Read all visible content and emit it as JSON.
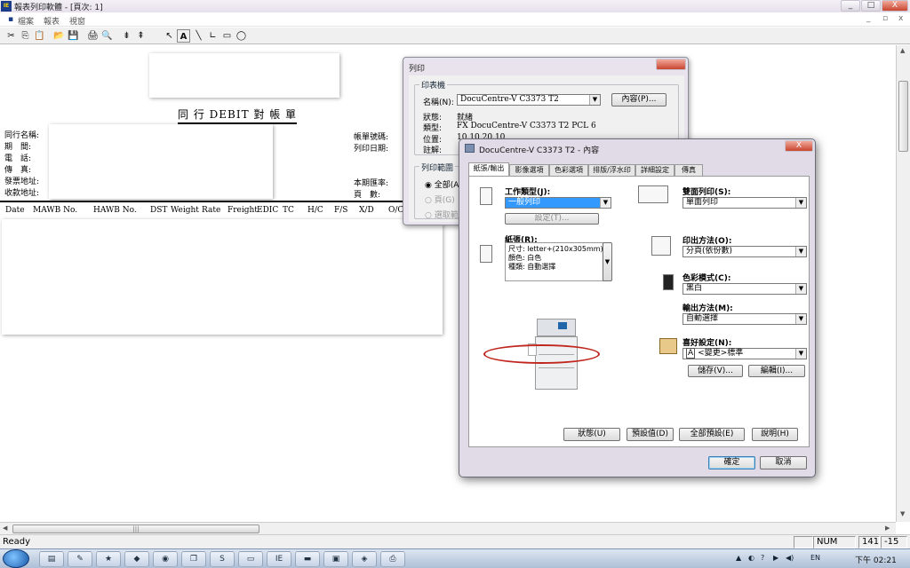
{
  "window": {
    "title": "報表列印軟體 - [頁次: 1]",
    "min": "_",
    "max": "□",
    "close": "X"
  },
  "menu": [
    "檔案",
    "報表",
    "視窗"
  ],
  "mdi_controls": [
    "_",
    "▫",
    "x"
  ],
  "toolbar": [
    "✂",
    "⎘",
    "📋",
    "📂",
    "💾",
    "🖨",
    "🔍",
    "⇟",
    "⇞",
    "↖",
    "A",
    "╲",
    "∟",
    "▭",
    "◯"
  ],
  "document": {
    "title": "同 行 DEBIT 對 帳 單",
    "left_labels": [
      "同行名稱:",
      "期　間:",
      "電　話:",
      "傳　真:",
      "發票地址:",
      "收款地址:"
    ],
    "right_labels": [
      "帳單號碼:",
      "列印日期:",
      "本期匯率:",
      "頁　數:"
    ],
    "columns": [
      "Date",
      "MAWB No.",
      "HAWB No.",
      "DST",
      "Weight",
      "Rate",
      "Freight",
      "EDIC",
      "TC",
      "H/C",
      "F/S",
      "X/D",
      "O/C"
    ]
  },
  "print_dialog": {
    "title": "列印",
    "printer_group": "印表機",
    "name_label": "名稱(N):",
    "name_value": "DocuCentre-V C3373 T2",
    "properties_button": "內容(P)...",
    "status_label": "狀態:",
    "status_value": "就緒",
    "type_label": "類型:",
    "type_value": "FX DocuCentre-V C3373 T2 PCL 6",
    "where_label": "位置:",
    "where_value": "10.10.20.10",
    "comment_label": "註解:",
    "range_group": "列印範圍",
    "range_all": "全部(A)",
    "range_pages": "頁(G)",
    "range_selection": "選取範"
  },
  "props_dialog": {
    "title": "DocuCentre-V C3373 T2 - 內容",
    "tabs": [
      "紙張/輸出",
      "影像選項",
      "色彩選項",
      "排版/浮水印",
      "詳細設定",
      "傳真"
    ],
    "job_type_label": "工作類型(J):",
    "job_type_value": "一般列印",
    "setup_button": "設定(T)...",
    "paper_label": "紙張(R):",
    "paper_size": "尺寸: letter+(210x305mm)",
    "paper_color": "顏色: 白色",
    "paper_type": "種類: 自動選擇",
    "duplex_label": "雙面列印(S):",
    "duplex_value": "單面列印",
    "output_mode_label": "印出方法(O):",
    "output_mode_value": "分頁(依份數)",
    "color_mode_label": "色彩模式(C):",
    "color_mode_value": "黑白",
    "output_dest_label": "輸出方法(M):",
    "output_dest_value": "自動選擇",
    "favorites_label": "喜好設定(N):",
    "favorites_badge": "A",
    "favorites_value": "<變更>標準",
    "save_button": "儲存(V)...",
    "edit_button": "編輯(I)...",
    "state_button": "狀態(U)",
    "defaults_button": "預設值(D)",
    "all_defaults_button": "全部預設(E)",
    "help_button": "說明(H)",
    "ok_button": "確定",
    "cancel_button": "取消"
  },
  "statusbar": {
    "ready": "Ready",
    "num": "NUM",
    "pos1": "141",
    "pos2": "-15"
  },
  "hscroll_thumb": "|||",
  "taskbar": {
    "clock": "下午 02:21",
    "tray": [
      "▲",
      "◐",
      "?",
      "▶",
      "◀)",
      "EN"
    ]
  }
}
